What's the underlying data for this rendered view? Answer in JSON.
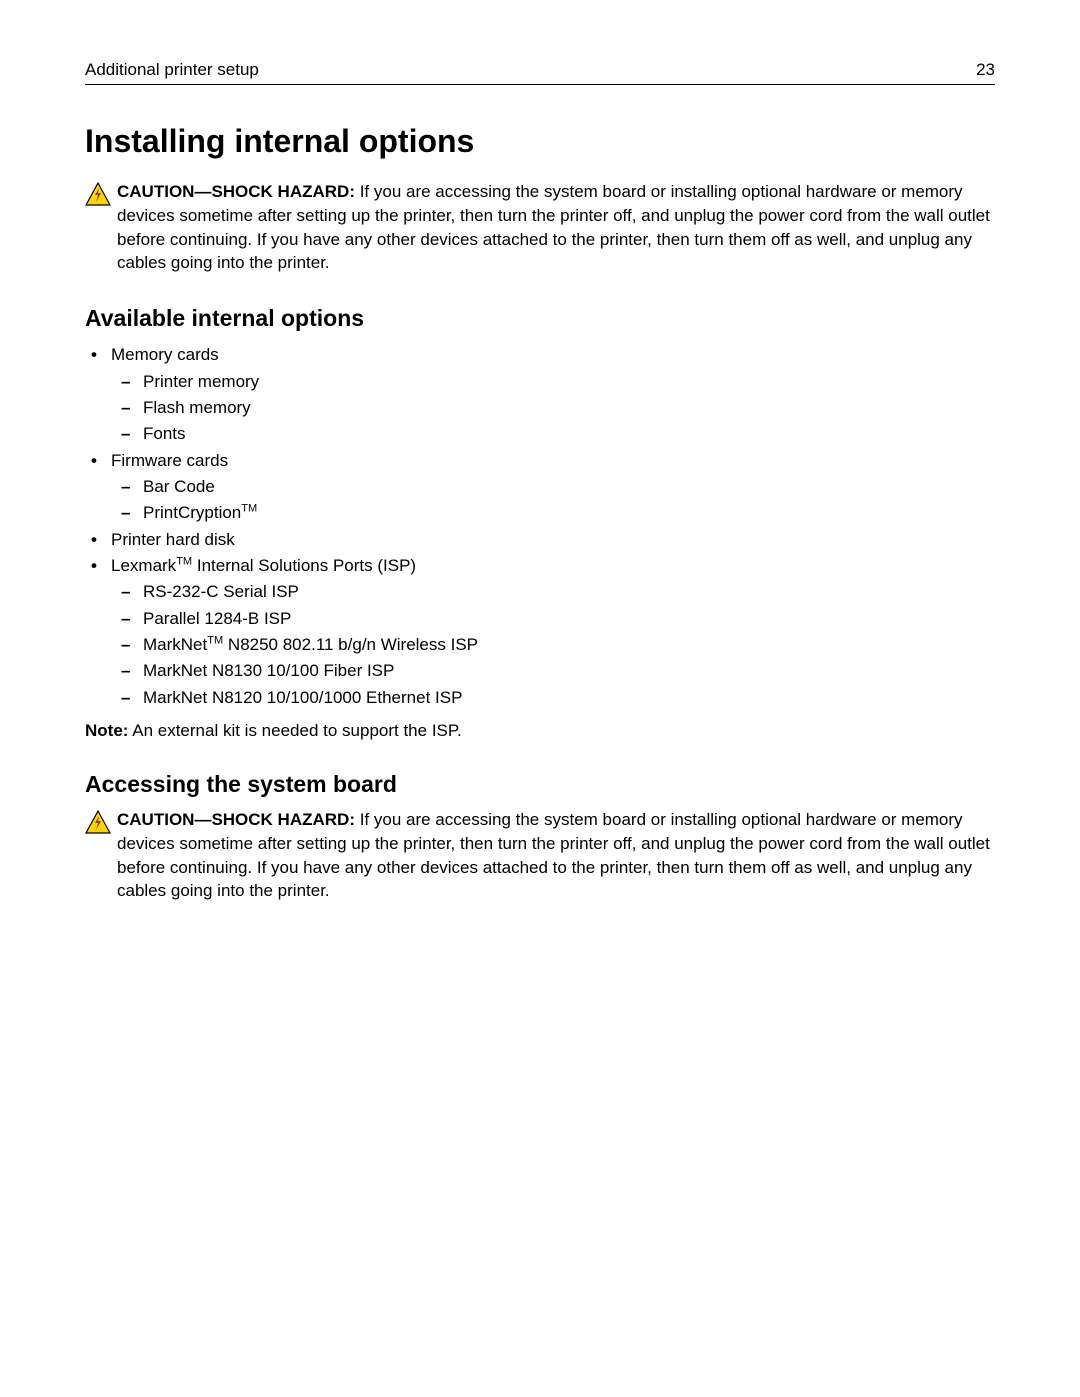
{
  "header": {
    "section": "Additional printer setup",
    "page_number": "23"
  },
  "h1": "Installing internal options",
  "caution1": {
    "label": "CAUTION—SHOCK HAZARD:",
    "text": " If you are accessing the system board or installing optional hardware or memory devices sometime after setting up the printer, then turn the printer off, and unplug the power cord from the wall outlet before continuing. If you have any other devices attached to the printer, then turn them off as well, and unplug any cables going into the printer."
  },
  "h2a": "Available internal options",
  "list": {
    "i1": "Memory cards",
    "i1a": "Printer memory",
    "i1b": "Flash memory",
    "i1c": "Fonts",
    "i2": "Firmware cards",
    "i2a": "Bar Code",
    "i2b_pre": "PrintCryption",
    "i2b_tm": "TM",
    "i3": "Printer hard disk",
    "i4_pre": "Lexmark",
    "i4_tm": "TM",
    "i4_post": " Internal Solutions Ports (ISP)",
    "i4a": "RS‑232‑C Serial ISP",
    "i4b": "Parallel 1284‑B ISP",
    "i4c_pre": "MarkNet",
    "i4c_tm": "TM",
    "i4c_post": " N8250 802.11 b/g/n Wireless ISP",
    "i4d": "MarkNet N8130 10/100 Fiber ISP",
    "i4e": "MarkNet N8120 10/100/1000 Ethernet ISP"
  },
  "note": {
    "label": "Note:",
    "text": " An external kit is needed to support the ISP."
  },
  "h2b": "Accessing the system board",
  "caution2": {
    "label": "CAUTION—SHOCK HAZARD:",
    "text": " If you are accessing the system board or installing optional hardware or memory devices sometime after setting up the printer, then turn the printer off, and unplug the power cord from the wall outlet before continuing. If you have any other devices attached to the printer, then turn them off as well, and unplug any cables going into the printer."
  }
}
